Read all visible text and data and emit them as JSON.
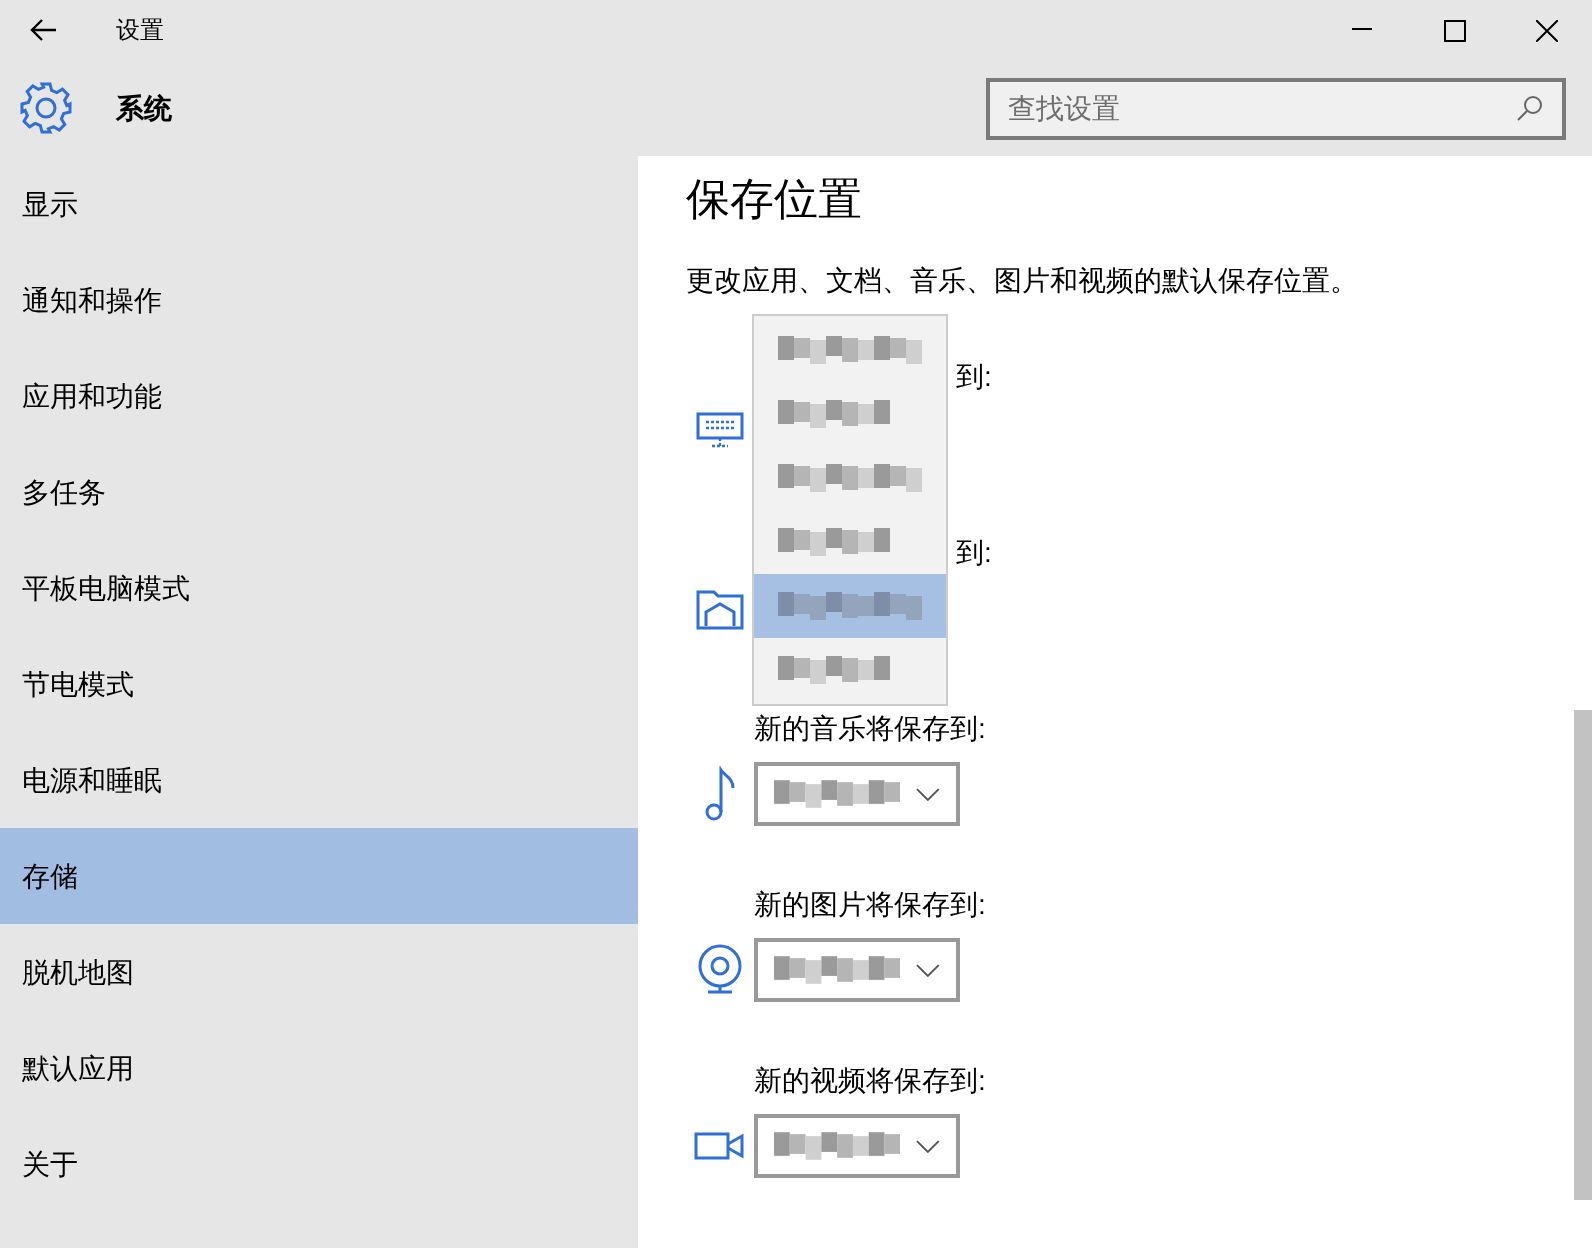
{
  "window": {
    "title": "设置"
  },
  "header": {
    "title": "系统",
    "search": {
      "placeholder": "查找设置"
    }
  },
  "sidebar": {
    "items": [
      {
        "label": "显示",
        "selected": false
      },
      {
        "label": "通知和操作",
        "selected": false
      },
      {
        "label": "应用和功能",
        "selected": false
      },
      {
        "label": "多任务",
        "selected": false
      },
      {
        "label": "平板电脑模式",
        "selected": false
      },
      {
        "label": "节电模式",
        "selected": false
      },
      {
        "label": "电源和睡眠",
        "selected": false
      },
      {
        "label": "存储",
        "selected": true
      },
      {
        "label": "脱机地图",
        "selected": false
      },
      {
        "label": "默认应用",
        "selected": false
      },
      {
        "label": "关于",
        "selected": false
      }
    ]
  },
  "content": {
    "title": "保存位置",
    "description": "更改应用、文档、音乐、图片和视频的默认保存位置。",
    "locations": [
      {
        "kind": "apps",
        "label": "到:",
        "covered": true
      },
      {
        "kind": "documents",
        "label": "到:",
        "covered": true
      },
      {
        "kind": "music",
        "label": "新的音乐将保存到:",
        "covered": false
      },
      {
        "kind": "pictures",
        "label": "新的图片将保存到:",
        "covered": false
      },
      {
        "kind": "videos",
        "label": "新的视频将保存到:",
        "covered": false
      }
    ],
    "popup": {
      "items": [
        {
          "selected": false
        },
        {
          "selected": false
        },
        {
          "selected": false
        },
        {
          "selected": false
        },
        {
          "selected": true
        },
        {
          "selected": false
        }
      ]
    }
  }
}
